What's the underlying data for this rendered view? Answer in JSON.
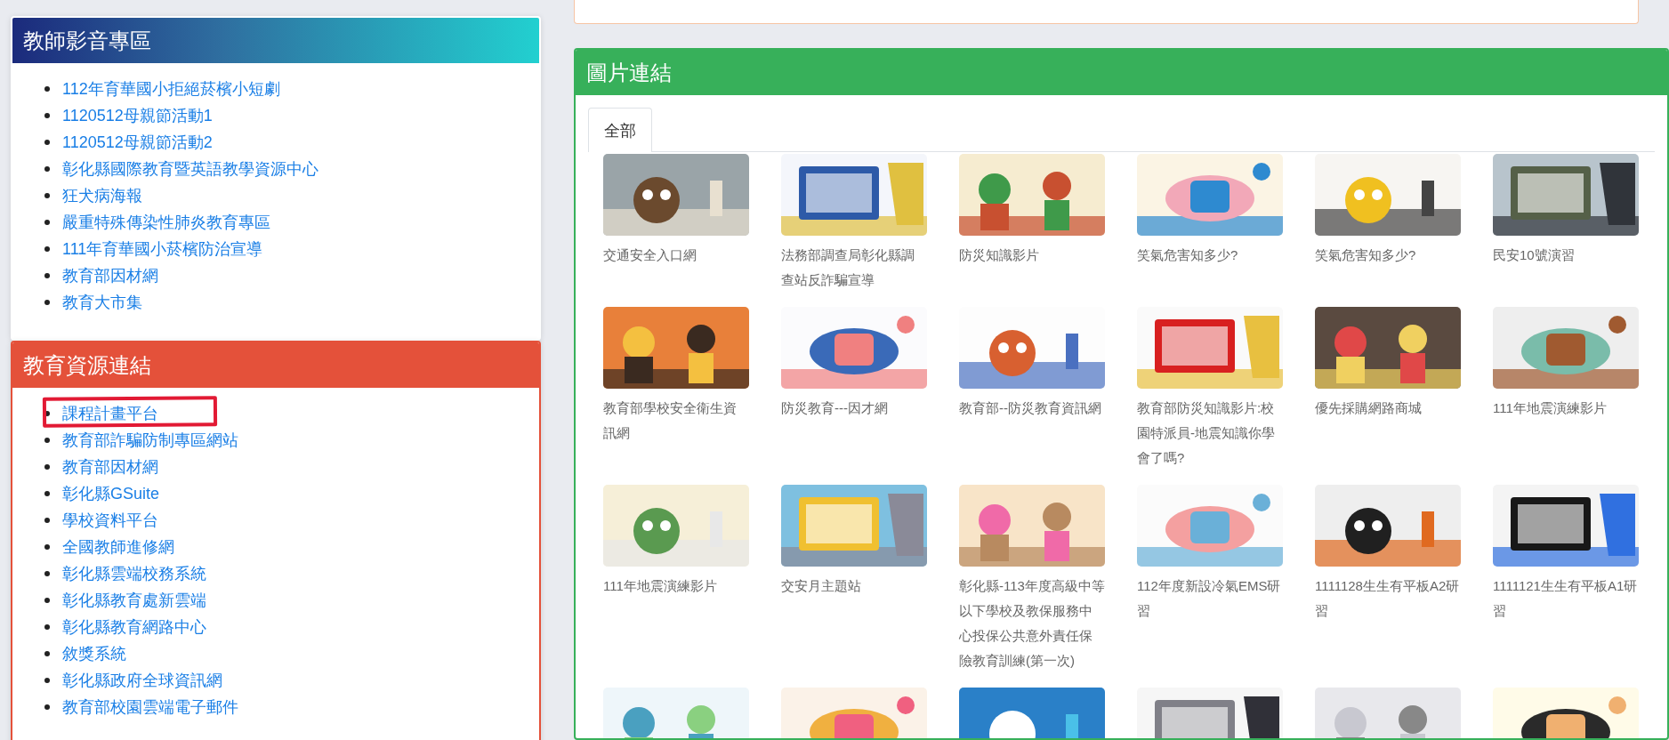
{
  "video_card": {
    "title": "教師影音專區",
    "links": [
      {
        "label": "112年育華國小拒絕菸檳小短劇"
      },
      {
        "label": "1120512母親節活動1"
      },
      {
        "label": "1120512母親節活動2"
      },
      {
        "label": "彰化縣國際教育暨英語教學資源中心"
      },
      {
        "label": "狂犬病海報"
      },
      {
        "label": "嚴重特殊傳染性肺炎教育專區"
      },
      {
        "label": "111年育華國小菸檳防治宣導"
      },
      {
        "label": "教育部因材網"
      },
      {
        "label": "教育大市集"
      }
    ]
  },
  "resource_card": {
    "title": "教育資源連結",
    "links": [
      {
        "label": "課程計畫平台",
        "highlighted": true
      },
      {
        "label": "教育部詐騙防制專區網站",
        "highlighted": false
      },
      {
        "label": "教育部因材網",
        "highlighted": false
      },
      {
        "label": "彰化縣GSuite",
        "highlighted": false
      },
      {
        "label": "學校資料平台",
        "highlighted": false
      },
      {
        "label": "全國教師進修網",
        "highlighted": false
      },
      {
        "label": "彰化縣雲端校務系統",
        "highlighted": false
      },
      {
        "label": "彰化縣教育處新雲端",
        "highlighted": false
      },
      {
        "label": "彰化縣教育網路中心",
        "highlighted": false
      },
      {
        "label": "敘獎系統",
        "highlighted": false
      },
      {
        "label": "彰化縣政府全球資訊網",
        "highlighted": false
      },
      {
        "label": "教育部校園雲端電子郵件",
        "highlighted": false
      }
    ]
  },
  "image_card": {
    "title": "圖片連結",
    "tabs": [
      {
        "label": "全部",
        "selected": true
      }
    ],
    "items": [
      {
        "kind": "picture",
        "caption": "交通安全入口網"
      },
      {
        "kind": "picture",
        "caption": "法務部調查局彰化縣調查站反詐騙宣導"
      },
      {
        "kind": "picture",
        "caption": "防災知識影片"
      },
      {
        "kind": "picture",
        "caption": "笑氣危害知多少?"
      },
      {
        "kind": "picture",
        "caption": "笑氣危害知多少?"
      },
      {
        "kind": "picture",
        "caption": "民安10號演習"
      },
      {
        "kind": "picture",
        "caption": "教育部學校安全衛生資訊網"
      },
      {
        "kind": "picture",
        "caption": "防災教育---因才網"
      },
      {
        "kind": "picture",
        "caption": "教育部--防災教育資訊網"
      },
      {
        "kind": "picture",
        "caption": "教育部防災知識影片:校園特派員-地震知識你學會了嗎?"
      },
      {
        "kind": "picture",
        "caption": "優先採購網路商城"
      },
      {
        "kind": "picture",
        "caption": "111年地震演練影片"
      },
      {
        "kind": "picture",
        "caption": "111年地震演練影片"
      },
      {
        "kind": "picture",
        "caption": "交安月主題站"
      },
      {
        "kind": "picture",
        "caption": "彰化縣-113年度高級中等以下學校及教保服務中心投保公共意外責任保險教育訓練(第一次)"
      },
      {
        "kind": "picture",
        "caption": "112年度新設冷氣EMS研習"
      },
      {
        "kind": "picture",
        "caption": "1111128生生有平板A2研習"
      },
      {
        "kind": "picture",
        "caption": "1111121生生有平板A1研習"
      },
      {
        "kind": "picture"
      },
      {
        "kind": "picture"
      },
      {
        "kind": "picture"
      },
      {
        "kind": "picture"
      },
      {
        "kind": "picture"
      },
      {
        "kind": "picture"
      }
    ]
  }
}
